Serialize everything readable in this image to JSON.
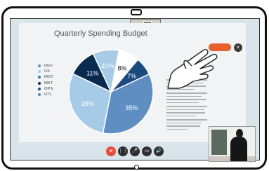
{
  "slide": {
    "title": "Quarterly Spending Budget",
    "legend": [
      {
        "label": "DEV",
        "color": "#5e8ec2"
      },
      {
        "label": "UX",
        "color": "#a7cbe6"
      },
      {
        "label": "MGT",
        "color": "#3b74ad"
      },
      {
        "label": "MKT",
        "color": "#0b2a4f"
      },
      {
        "label": "OPS",
        "color": "#1c4a80"
      },
      {
        "label": "UTL",
        "color": "#4a85bd"
      }
    ]
  },
  "chart_data": {
    "type": "pie",
    "title": "Quarterly Spending Budget",
    "categories": [
      "DEV",
      "UX",
      "MGT",
      "MKT",
      "OPS",
      "UTL"
    ],
    "values": [
      35,
      29,
      11,
      10,
      8,
      7
    ],
    "labels": [
      "35%",
      "29%",
      "11%",
      "10%",
      "8%",
      "7%"
    ],
    "colors": [
      "#5e8ec2",
      "#a7cbe6",
      "#0b2a4f",
      "#a7cbe6",
      "#ffffff",
      "#1c4a80"
    ]
  },
  "controls": {
    "end_icon": "✕",
    "keypad_icon": "⋮⋮",
    "mic_icon": "🎤",
    "camera_icon": "▭",
    "volume_icon": "🔊"
  },
  "overlay": {
    "record_label": "",
    "close_icon": "×"
  }
}
